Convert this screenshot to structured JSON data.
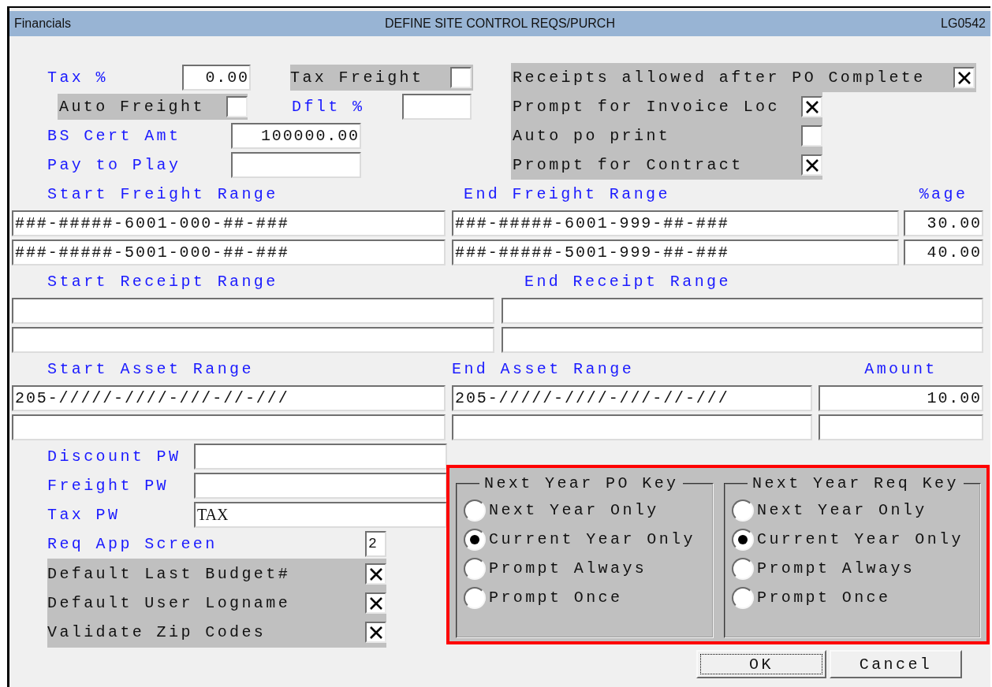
{
  "title_bar": {
    "app": "Financials",
    "title": "DEFINE SITE CONTROL REQS/PURCH",
    "code": "LG0542"
  },
  "tax_percent": {
    "label": "Tax %",
    "value": "0.00"
  },
  "tax_freight": {
    "label": "Tax Freight",
    "checked": false
  },
  "auto_freight": {
    "label": "Auto Freight",
    "checked": false
  },
  "dflt_percent": {
    "label": "Dflt %"
  },
  "bs_cert_amt": {
    "label": "BS Cert Amt",
    "value": "100000.00"
  },
  "pay_to_play": {
    "label": "Pay to Play"
  },
  "site_options": [
    {
      "label": "Receipts allowed after PO Complete",
      "checked": true
    },
    {
      "label": "Prompt for Invoice Loc",
      "checked": true
    },
    {
      "label": "Auto po print",
      "checked": false
    },
    {
      "label": "Prompt for Contract",
      "checked": true
    }
  ],
  "freight_ranges": {
    "columns": [
      "Start Freight Range",
      "End Freight Range",
      "%age"
    ],
    "rows": [
      [
        "###-#####-6001-000-##-###",
        "###-#####-6001-999-##-###",
        "30.00"
      ],
      [
        "###-#####-5001-000-##-###",
        "###-#####-5001-999-##-###",
        "40.00"
      ]
    ]
  },
  "receipt_ranges": {
    "columns": [
      "Start Receipt Range",
      "End Receipt Range"
    ]
  },
  "asset_ranges": {
    "columns": [
      "Start Asset Range",
      "End Asset Range",
      "Amount"
    ],
    "rows": [
      [
        "205-/////-////-///-//-///",
        "205-/////-////-///-//-///",
        "10.00"
      ]
    ]
  },
  "passwords": [
    {
      "label": "Discount PW"
    },
    {
      "label": "Freight PW"
    },
    {
      "label": "Tax PW",
      "value": "TAX"
    }
  ],
  "req_app_screen": {
    "label": "Req App Screen",
    "value": "2"
  },
  "defaults": [
    {
      "label": "Default Last Budget#",
      "checked": true
    },
    {
      "label": "Default User Logname",
      "checked": true
    },
    {
      "label": "Validate Zip Codes",
      "checked": true
    }
  ],
  "radio_groups": [
    {
      "title": "Next Year PO Key",
      "options": [
        {
          "label": "Next Year Only",
          "selected": false
        },
        {
          "label": "Current Year Only",
          "selected": true
        },
        {
          "label": "Prompt Always",
          "selected": false
        },
        {
          "label": "Prompt Once",
          "selected": false
        }
      ]
    },
    {
      "title": "Next Year Req Key",
      "options": [
        {
          "label": "Next Year Only",
          "selected": false
        },
        {
          "label": "Current Year Only",
          "selected": true
        },
        {
          "label": "Prompt Always",
          "selected": false
        },
        {
          "label": "Prompt Once",
          "selected": false
        }
      ]
    }
  ],
  "buttons": [
    {
      "label": "OK",
      "focused": true
    },
    {
      "label": "Cancel",
      "focused": false
    }
  ]
}
